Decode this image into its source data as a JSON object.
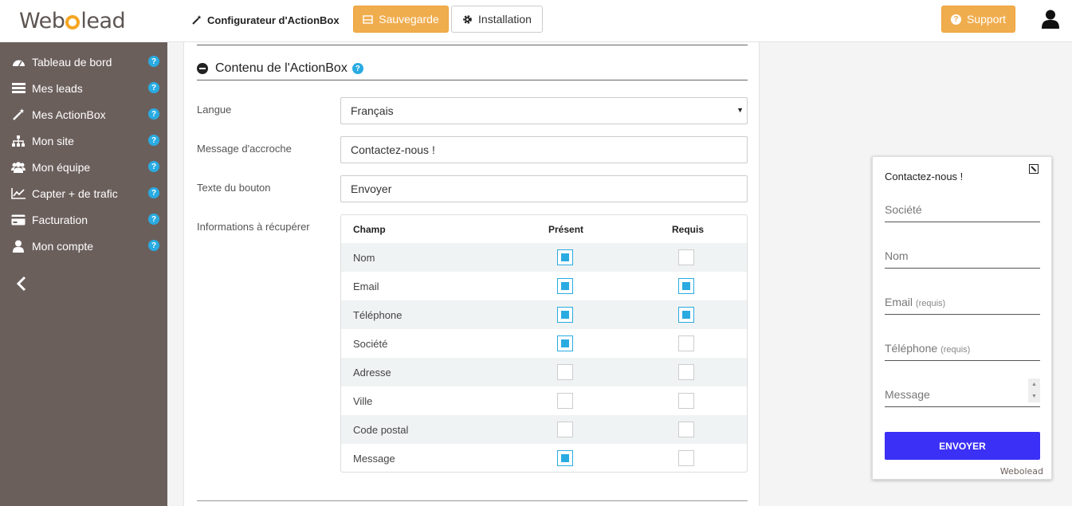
{
  "header": {
    "logo_text": "Webolead",
    "config_title": "Configurateur d'ActionBox",
    "save_label": "Sauvegarde",
    "install_label": "Installation",
    "support_label": "Support"
  },
  "sidebar": {
    "items": [
      {
        "label": "Tableau de bord",
        "icon": "dashboard-icon"
      },
      {
        "label": "Mes leads",
        "icon": "list-icon"
      },
      {
        "label": "Mes ActionBox",
        "icon": "magic-wand-icon"
      },
      {
        "label": "Mon site",
        "icon": "sitemap-icon"
      },
      {
        "label": "Mon équipe",
        "icon": "team-icon"
      },
      {
        "label": "Capter + de trafic",
        "icon": "chart-line-icon"
      },
      {
        "label": "Facturation",
        "icon": "credit-card-icon"
      },
      {
        "label": "Mon compte",
        "icon": "user-icon"
      }
    ],
    "help_glyph": "?",
    "collapse_glyph": "<"
  },
  "section": {
    "title": "Contenu de l'ActionBox"
  },
  "form": {
    "langue_label": "Langue",
    "langue_value": "Français",
    "accroche_label": "Message d'accroche",
    "accroche_value": "Contactez-nous !",
    "bouton_label": "Texte du bouton",
    "bouton_value": "Envoyer",
    "infos_label": "Informations à récupérer"
  },
  "table": {
    "headers": {
      "champ": "Champ",
      "present": "Présent",
      "requis": "Requis"
    },
    "rows": [
      {
        "champ": "Nom",
        "present": true,
        "requis": false
      },
      {
        "champ": "Email",
        "present": true,
        "requis": true
      },
      {
        "champ": "Téléphone",
        "present": true,
        "requis": true
      },
      {
        "champ": "Société",
        "present": true,
        "requis": false
      },
      {
        "champ": "Adresse",
        "present": false,
        "requis": false
      },
      {
        "champ": "Ville",
        "present": false,
        "requis": false
      },
      {
        "champ": "Code postal",
        "present": false,
        "requis": false
      },
      {
        "champ": "Message",
        "present": true,
        "requis": false
      }
    ]
  },
  "preview": {
    "title": "Contactez-nous !",
    "fields": [
      {
        "label": "Société",
        "note": ""
      },
      {
        "label": "Nom",
        "note": ""
      },
      {
        "label": "Email",
        "note": "(requis)"
      },
      {
        "label": "Téléphone",
        "note": "(requis)"
      },
      {
        "label": "Message",
        "note": ""
      }
    ],
    "button_label": "ENVOYER",
    "brand": "Webolead"
  },
  "colors": {
    "accent": "#f0ad4e",
    "sidebar": "#6b5f5c",
    "checkbox": "#29abe2",
    "submit": "#3b30f5"
  }
}
